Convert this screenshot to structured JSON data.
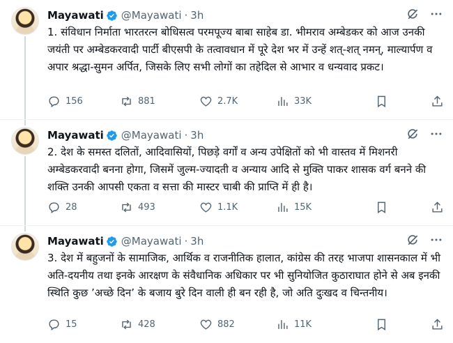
{
  "tweets": [
    {
      "author": "Mayawati",
      "handle": "@Mayawati",
      "separator": "·",
      "time": "3h",
      "text": "1. संविधान निर्माता भारतरत्न बोधिसत्व परमपूज्य बाबा साहेब डा. भीमराव अम्बेडकर को आज उनकी जयंती पर अम्बेडकरवादी पार्टी बीएसपी के तत्वावधान में पूरे देश भर में उन्हें शत्-शत् नमन्, माल्यार्पण व अपार श्रद्धा-सुमन अर्पित, जिसके लिए सभी लोगों का तहेदिल से आभार व धन्यवाद प्रकट।",
      "stats": {
        "replies": "156",
        "reposts": "881",
        "likes": "2.7K",
        "views": "33K"
      }
    },
    {
      "author": "Mayawati",
      "handle": "@Mayawati",
      "separator": "·",
      "time": "3h",
      "text": "2. देश के समस्त दलितों, आदिवासियों, पिछड़े वर्गों व अन्य उपेक्षितों को भी वास्तव में मिशनरी अम्बेडकरवादी बनना होगा, जिसमें जुल्म-ज्यादती व अन्याय आदि से मुक्ति पाकर शासक वर्ग बनने की शक्ति उनकी आपसी एकता व सत्ता की मास्टर चाबी की प्राप्ति में ही है।",
      "stats": {
        "replies": "28",
        "reposts": "493",
        "likes": "1.1K",
        "views": "15K"
      }
    },
    {
      "author": "Mayawati",
      "handle": "@Mayawati",
      "separator": "·",
      "time": "3h",
      "text": "3. देश में बहुजनों के सामाजिक, आर्थिक व राजनीतिक हालात, कांग्रेस की तरह भाजपा शासनकाल में भी अति-दयनीय तथा इनके आरक्षण के संवैधानिक अधिकार पर भी सुनियोजित कुठाराघात होने से अब इनकी स्थिति कुछ ’अच्छे दिन’ के बजाय बुरे दिन वाली ही बन रही है, जो अति दुःखद व चिन्तनीय।",
      "stats": {
        "replies": "15",
        "reposts": "428",
        "likes": "882",
        "views": "11K"
      }
    }
  ],
  "colors": {
    "verified": "#1d9bf0",
    "muted": "#536471",
    "thread_line": "#cfd9de"
  },
  "icons": [
    "verified-badge-icon",
    "grok-icon",
    "more-icon",
    "reply-icon",
    "repost-icon",
    "like-icon",
    "views-icon",
    "bookmark-icon",
    "share-icon"
  ]
}
